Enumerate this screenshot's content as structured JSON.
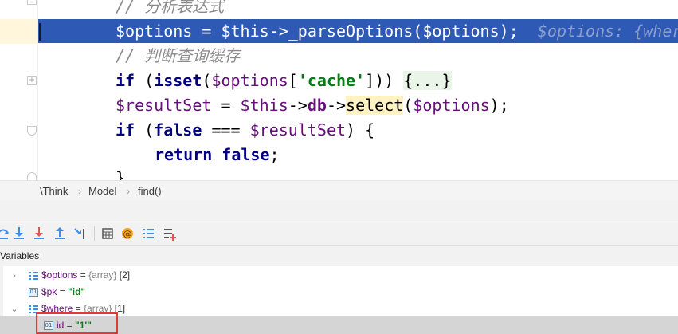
{
  "editor": {
    "lines": [
      {
        "segments": [
          {
            "cls": "c-comment",
            "text": "// 分析表达式"
          }
        ]
      },
      {
        "segments": [
          {
            "cls": "c-sel-text",
            "text": "$options = $this->_parseOptions($options);"
          },
          {
            "cls": "c-hint",
            "text": "  $options: {wher"
          }
        ]
      },
      {
        "segments": [
          {
            "cls": "c-comment",
            "text": "// 判断查询缓存"
          }
        ]
      },
      {
        "segments": [
          {
            "cls": "c-kw",
            "text": "if"
          },
          {
            "cls": "",
            "text": " ("
          },
          {
            "cls": "c-kw",
            "text": "isset"
          },
          {
            "cls": "",
            "text": "("
          },
          {
            "cls": "c-var",
            "text": "$options"
          },
          {
            "cls": "",
            "text": "["
          },
          {
            "cls": "c-str",
            "text": "'cache'"
          },
          {
            "cls": "",
            "text": "])) "
          },
          {
            "cls": "c-folded",
            "text": "{...}"
          }
        ]
      },
      {
        "segments": [
          {
            "cls": "c-var",
            "text": "$resultSet"
          },
          {
            "cls": "",
            "text": " = "
          },
          {
            "cls": "c-var",
            "text": "$this"
          },
          {
            "cls": "",
            "text": "->"
          },
          {
            "cls": "c-member",
            "text": "db"
          },
          {
            "cls": "",
            "text": "->"
          },
          {
            "cls": "c-hl",
            "text": "select"
          },
          {
            "cls": "",
            "text": "("
          },
          {
            "cls": "c-var",
            "text": "$options"
          },
          {
            "cls": "",
            "text": ");"
          }
        ]
      },
      {
        "segments": [
          {
            "cls": "c-kw",
            "text": "if"
          },
          {
            "cls": "",
            "text": " ("
          },
          {
            "cls": "c-kw",
            "text": "false"
          },
          {
            "cls": "",
            "text": " === "
          },
          {
            "cls": "c-var",
            "text": "$resultSet"
          },
          {
            "cls": "",
            "text": ") {"
          }
        ]
      },
      {
        "segments": [
          {
            "cls": "c-kw",
            "text": "return"
          },
          {
            "cls": "",
            "text": " "
          },
          {
            "cls": "c-kw",
            "text": "false"
          },
          {
            "cls": "",
            "text": ";"
          }
        ]
      },
      {
        "segments": [
          {
            "cls": "",
            "text": "}"
          }
        ]
      }
    ]
  },
  "breadcrumb": {
    "items": [
      "\\Think",
      "Model",
      "find()"
    ],
    "separator": "›"
  },
  "toolbar": {
    "buttons": [
      {
        "name": "step-over-icon",
        "label": "Step Over"
      },
      {
        "name": "step-into-icon",
        "label": "Step Into"
      },
      {
        "name": "force-step-into-icon",
        "label": "Force Step Into"
      },
      {
        "name": "step-out-icon",
        "label": "Step Out"
      },
      {
        "name": "run-to-cursor-icon",
        "label": "Run to Cursor"
      },
      {
        "name": "evaluate-expression-icon",
        "label": "Evaluate Expression"
      },
      {
        "name": "watch-icon",
        "label": "Watch"
      },
      {
        "name": "list-icon",
        "label": "List"
      },
      {
        "name": "add-watch-icon",
        "label": "Add Watch"
      }
    ]
  },
  "variables": {
    "title": "Variables",
    "rows": [
      {
        "expander": "›",
        "icon": "array",
        "name": "$options",
        "eq": " = ",
        "type": "{array}",
        "count": " [2]",
        "value": ""
      },
      {
        "expander": "",
        "icon": "primitive",
        "name": "$pk",
        "eq": " = ",
        "type": "",
        "count": "",
        "value": "\"id\""
      },
      {
        "expander": "⌄",
        "icon": "array",
        "name": "$where",
        "eq": " = ",
        "type": "{array}",
        "count": " [1]",
        "value": ""
      },
      {
        "expander": "",
        "icon": "primitive",
        "name": "id",
        "eq": " = ",
        "type": "",
        "count": "",
        "value": "\"1'\""
      }
    ]
  },
  "colors": {
    "selection": "#2e5ab6",
    "highlight_box": "#e53935",
    "string": "#067d17",
    "keyword": "#000080",
    "variable": "#660e7a"
  }
}
